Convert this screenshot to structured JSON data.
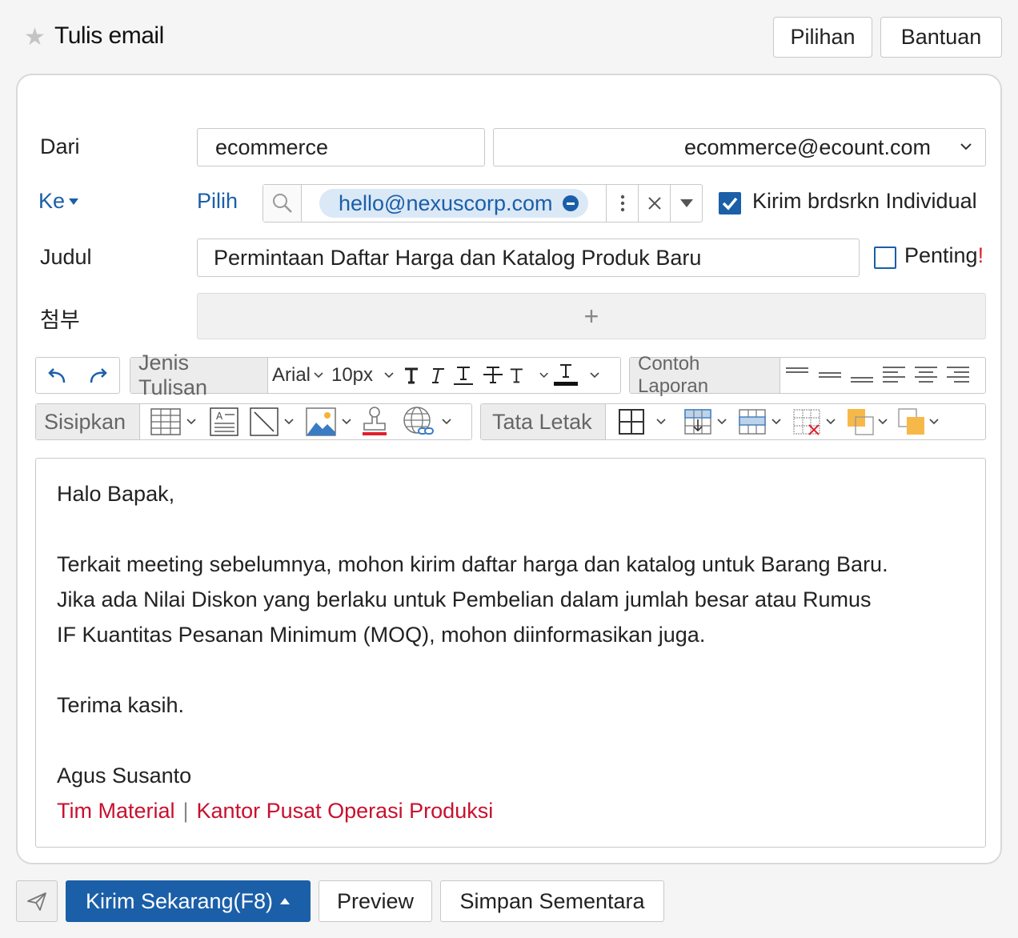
{
  "header": {
    "title": "Tulis email",
    "options_label": "Pilihan",
    "help_label": "Bantuan"
  },
  "form": {
    "from_label": "Dari",
    "from_name": "ecommerce",
    "from_email": "ecommerce@ecount.com",
    "to_label": "Ke",
    "select_label": "Pilih",
    "recipient": "hello@nexuscorp.com",
    "individual_label": "Kirim brdsrkn Individual",
    "individual_checked": true,
    "subject_label": "Judul",
    "subject_value": "Permintaan Daftar Harga dan Katalog Produk Baru",
    "important_label": "Penting",
    "important_mark": "!",
    "important_checked": false,
    "attach_label": "첨부",
    "attach_add": "+"
  },
  "toolbar": {
    "font_type_label": "Jenis Tulisan",
    "font_name": "Arial",
    "font_size": "10px",
    "report_sample_label": "Contoh Laporan",
    "insert_label": "Sisipkan",
    "layout_label": "Tata Letak"
  },
  "body": {
    "greeting": "Halo Bapak,",
    "line1": "Terkait meeting sebelumnya, mohon kirim daftar harga dan katalog untuk Barang Baru.",
    "line2": "Jika ada Nilai Diskon yang berlaku untuk Pembelian dalam jumlah besar atau Rumus",
    "line3": "IF Kuantitas Pesanan Minimum (MOQ), mohon diinformasikan juga.",
    "closing": "Terima kasih.",
    "sender_name": "Agus Susanto",
    "team": "Tim Material",
    "divider": "|",
    "office": "Kantor Pusat Operasi Produksi"
  },
  "footer": {
    "send_label": "Kirim Sekarang(F8)",
    "preview_label": "Preview",
    "save_label": "Simpan Sementara"
  },
  "colors": {
    "accent": "#1a5fa8",
    "signature_red": "#c8102e",
    "important_red": "#e0202a"
  }
}
